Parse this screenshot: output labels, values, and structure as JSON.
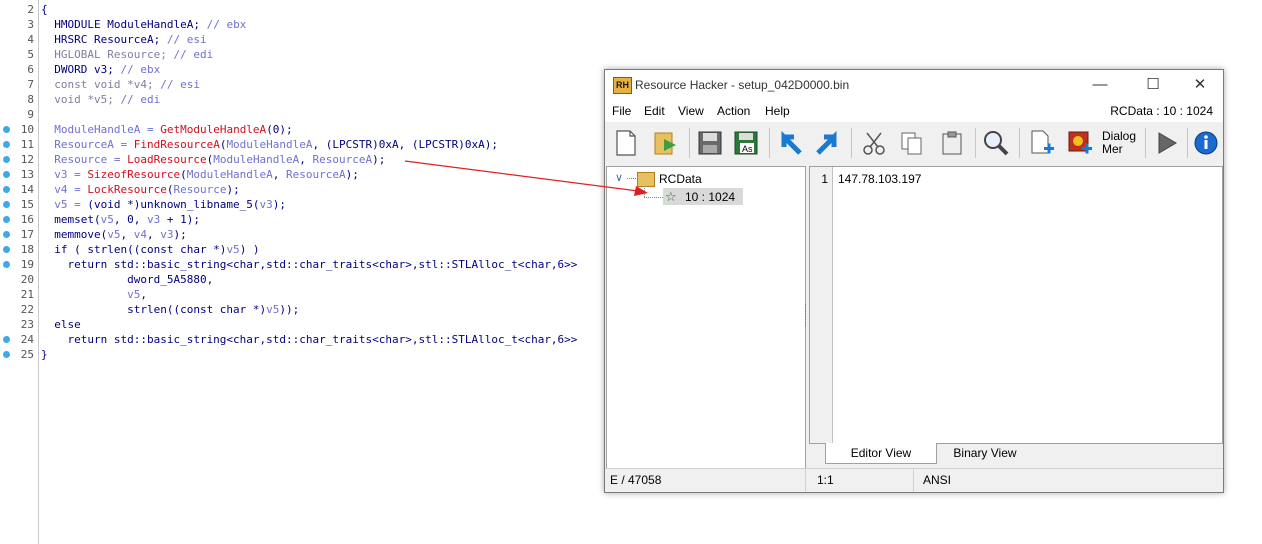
{
  "code": {
    "lines": [
      {
        "num": "2",
        "bp": false,
        "parts": [
          {
            "t": "{",
            "c": "k"
          }
        ]
      },
      {
        "num": "3",
        "bp": false,
        "parts": [
          {
            "t": "  HMODULE ModuleHandleA; ",
            "c": "k"
          },
          {
            "t": "// ebx",
            "c": "c"
          }
        ]
      },
      {
        "num": "4",
        "bp": false,
        "parts": [
          {
            "t": "  HRSRC ResourceA; ",
            "c": "k"
          },
          {
            "t": "// esi",
            "c": "c"
          }
        ]
      },
      {
        "num": "5",
        "bp": false,
        "parts": [
          {
            "t": "  HGLOBAL Resource; ",
            "c": "g"
          },
          {
            "t": "// edi",
            "c": "c"
          }
        ]
      },
      {
        "num": "6",
        "bp": false,
        "parts": [
          {
            "t": "  DWORD v3; ",
            "c": "k"
          },
          {
            "t": "// ebx",
            "c": "c"
          }
        ]
      },
      {
        "num": "7",
        "bp": false,
        "parts": [
          {
            "t": "  const void *v4; ",
            "c": "g"
          },
          {
            "t": "// esi",
            "c": "c"
          }
        ]
      },
      {
        "num": "8",
        "bp": false,
        "parts": [
          {
            "t": "  void *v5; ",
            "c": "g"
          },
          {
            "t": "// edi",
            "c": "c"
          }
        ]
      },
      {
        "num": "9",
        "bp": false,
        "parts": [
          {
            "t": "",
            "c": "k"
          }
        ]
      },
      {
        "num": "10",
        "bp": true,
        "parts": [
          {
            "t": "  ModuleHandleA = ",
            "c": "c"
          },
          {
            "t": "GetModuleHandleA",
            "c": "f"
          },
          {
            "t": "(0);",
            "c": "k"
          }
        ]
      },
      {
        "num": "11",
        "bp": true,
        "parts": [
          {
            "t": "  ResourceA = ",
            "c": "c"
          },
          {
            "t": "FindResourceA",
            "c": "f"
          },
          {
            "t": "(",
            "c": "k"
          },
          {
            "t": "ModuleHandleA",
            "c": "c"
          },
          {
            "t": ", (LPCSTR)0xA, (LPCSTR)0xA);",
            "c": "k"
          }
        ]
      },
      {
        "num": "12",
        "bp": true,
        "parts": [
          {
            "t": "  Resource = ",
            "c": "c"
          },
          {
            "t": "LoadResource",
            "c": "f"
          },
          {
            "t": "(",
            "c": "k"
          },
          {
            "t": "ModuleHandleA",
            "c": "c"
          },
          {
            "t": ", ",
            "c": "k"
          },
          {
            "t": "ResourceA",
            "c": "c"
          },
          {
            "t": ");",
            "c": "k"
          }
        ]
      },
      {
        "num": "13",
        "bp": true,
        "parts": [
          {
            "t": "  v3 = ",
            "c": "c"
          },
          {
            "t": "SizeofResource",
            "c": "f"
          },
          {
            "t": "(",
            "c": "k"
          },
          {
            "t": "ModuleHandleA",
            "c": "c"
          },
          {
            "t": ", ",
            "c": "k"
          },
          {
            "t": "ResourceA",
            "c": "c"
          },
          {
            "t": ");",
            "c": "k"
          }
        ]
      },
      {
        "num": "14",
        "bp": true,
        "parts": [
          {
            "t": "  v4 = ",
            "c": "c"
          },
          {
            "t": "LockResource",
            "c": "f"
          },
          {
            "t": "(",
            "c": "k"
          },
          {
            "t": "Resource",
            "c": "c"
          },
          {
            "t": ");",
            "c": "k"
          }
        ]
      },
      {
        "num": "15",
        "bp": true,
        "parts": [
          {
            "t": "  v5 = ",
            "c": "c"
          },
          {
            "t": "(void *)unknown_libname_5(",
            "c": "k"
          },
          {
            "t": "v3",
            "c": "c"
          },
          {
            "t": ");",
            "c": "k"
          }
        ]
      },
      {
        "num": "16",
        "bp": true,
        "parts": [
          {
            "t": "  memset(",
            "c": "k"
          },
          {
            "t": "v5",
            "c": "c"
          },
          {
            "t": ", 0, ",
            "c": "k"
          },
          {
            "t": "v3",
            "c": "c"
          },
          {
            "t": " + 1);",
            "c": "k"
          }
        ]
      },
      {
        "num": "17",
        "bp": true,
        "parts": [
          {
            "t": "  memmove(",
            "c": "k"
          },
          {
            "t": "v5",
            "c": "c"
          },
          {
            "t": ", ",
            "c": "k"
          },
          {
            "t": "v4",
            "c": "c"
          },
          {
            "t": ", ",
            "c": "k"
          },
          {
            "t": "v3",
            "c": "c"
          },
          {
            "t": ");",
            "c": "k"
          }
        ]
      },
      {
        "num": "18",
        "bp": true,
        "parts": [
          {
            "t": "  if ( strlen((const char *)",
            "c": "k"
          },
          {
            "t": "v5",
            "c": "c"
          },
          {
            "t": ") )",
            "c": "k"
          }
        ]
      },
      {
        "num": "19",
        "bp": true,
        "parts": [
          {
            "t": "    return std::basic_string<char,std::char_traits<char>,stl::STLAlloc_t<char,6>>",
            "c": "k"
          }
        ]
      },
      {
        "num": "20",
        "bp": false,
        "parts": [
          {
            "t": "             dword_5A5880,",
            "c": "k"
          }
        ]
      },
      {
        "num": "21",
        "bp": false,
        "parts": [
          {
            "t": "             ",
            "c": "k"
          },
          {
            "t": "v5",
            "c": "c"
          },
          {
            "t": ",",
            "c": "k"
          }
        ]
      },
      {
        "num": "22",
        "bp": false,
        "parts": [
          {
            "t": "             strlen((const char *)",
            "c": "k"
          },
          {
            "t": "v5",
            "c": "c"
          },
          {
            "t": "));",
            "c": "k"
          }
        ]
      },
      {
        "num": "23",
        "bp": false,
        "parts": [
          {
            "t": "  else",
            "c": "k"
          }
        ]
      },
      {
        "num": "24",
        "bp": true,
        "parts": [
          {
            "t": "    return std::basic_string<char,std::char_traits<char>,stl::STLAlloc_t<char,6>>",
            "c": "k"
          }
        ]
      },
      {
        "num": "25",
        "bp": true,
        "parts": [
          {
            "t": "}",
            "c": "k"
          }
        ]
      }
    ]
  },
  "rh": {
    "logo": "RH",
    "title": "Resource Hacker - setup_042D0000.bin",
    "minimize": "—",
    "maximize": "☐",
    "close": "✕",
    "menus": [
      "File",
      "Edit",
      "View",
      "Action",
      "Help"
    ],
    "resource_type": "RCData : 10 : 1024",
    "toolbar_dialog_label": "Dialog Mer",
    "tree": {
      "root": "RCData",
      "item": "10 : 1024"
    },
    "editor": {
      "line_number": "1",
      "text": "147.78.103.197"
    },
    "tabs": {
      "editor": "Editor View",
      "binary": "Binary View"
    },
    "status": {
      "size": "E / 47058",
      "position": "1:1",
      "encoding": "ANSI"
    }
  },
  "colors": {
    "arrow": "#e02020",
    "breakpoint": "#3da9ea"
  }
}
